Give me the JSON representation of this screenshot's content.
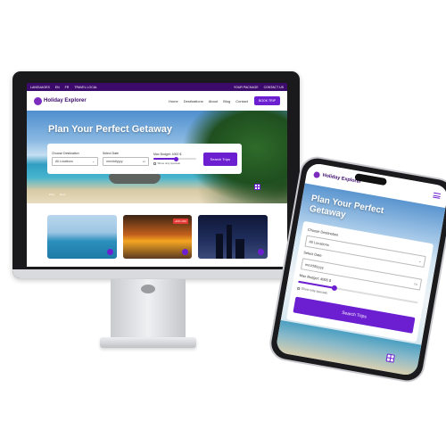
{
  "desktop": {
    "topbar": {
      "left": [
        "LANGUAGES",
        "EN",
        "FR",
        "TRAVEL LOCAL"
      ],
      "right": [
        "YOUR PACKAGE",
        "CONTACT US"
      ]
    },
    "nav": {
      "logo": "Holiday Explorer",
      "links": [
        "Home",
        "Destinations",
        "About",
        "Blog",
        "Contact"
      ],
      "cta": "BOOK TRIP"
    },
    "hero": {
      "title": "Plan Your Perfect Getaway",
      "destination_label": "Choose Destination",
      "destination_value": "All Locations",
      "date_label": "Select Date",
      "date_placeholder": "mm/dd/yyyy",
      "budget_label": "Max Budget: 4000 $",
      "budget_fraction": 0.55,
      "checkbox_label": "Show only specials",
      "search_button": "Search Trips",
      "dots": [
        "Prev",
        "Next"
      ]
    },
    "cards": [
      {
        "theme": "beach",
        "badge": ""
      },
      {
        "theme": "sunset",
        "badge": "-20% OFF"
      },
      {
        "theme": "city",
        "badge": ""
      }
    ]
  },
  "phone": {
    "logo": "Holiday Explorer",
    "title_line1": "Plan Your Perfect",
    "title_line2": "Getaway",
    "destination_label": "Choose Destination",
    "destination_value": "All Locations",
    "date_label": "Select Date",
    "date_placeholder": "mm/dd/yyyy",
    "budget_label": "Max Budget: 4000 $",
    "budget_fraction": 0.3,
    "checkbox_label": "Show only specials",
    "search_button": "Search Trips"
  },
  "colors": {
    "brand": "#6c1fd1",
    "topbar": "#3b0a6b"
  }
}
